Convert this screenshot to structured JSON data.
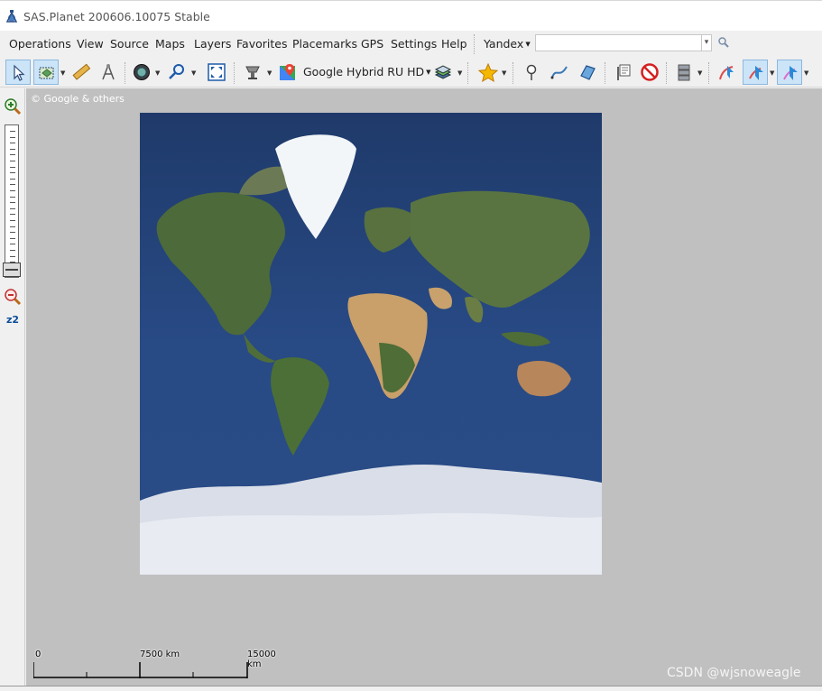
{
  "window": {
    "title": "SAS.Planet 200606.10075 Stable"
  },
  "menu": {
    "items": [
      "Operations",
      "View",
      "Source",
      "Maps",
      "Layers",
      "Favorites",
      "Placemarks",
      "GPS",
      "Settings",
      "Help"
    ]
  },
  "search": {
    "engine": "Yandex",
    "value": "",
    "placeholder": ""
  },
  "toolbar": {
    "map_source": "Google Hybrid RU HD"
  },
  "zoom": {
    "level": "z2"
  },
  "map": {
    "attribution": "© Google & others",
    "scale": {
      "labels": [
        "0",
        "7500 km",
        "15000 km"
      ]
    }
  },
  "watermark": "CSDN @wjsnoweagle",
  "icons": {
    "app": "satellite-app-icon",
    "toolbar": [
      "pointer-arrow-icon",
      "layers-select-icon",
      "ruler-icon",
      "compass-icon",
      "globe-icon",
      "magnifier-icon",
      "fullscreen-icon",
      "satellite-icon",
      "google-maps-icon",
      "layers-stack-icon",
      "favorite-star-icon",
      "add-point-icon",
      "add-path-icon",
      "add-polygon-icon",
      "placemark-list-icon",
      "no-entry-icon",
      "database-icon",
      "gps-track-icon",
      "gps-center-icon",
      "gps-follow-icon"
    ]
  }
}
